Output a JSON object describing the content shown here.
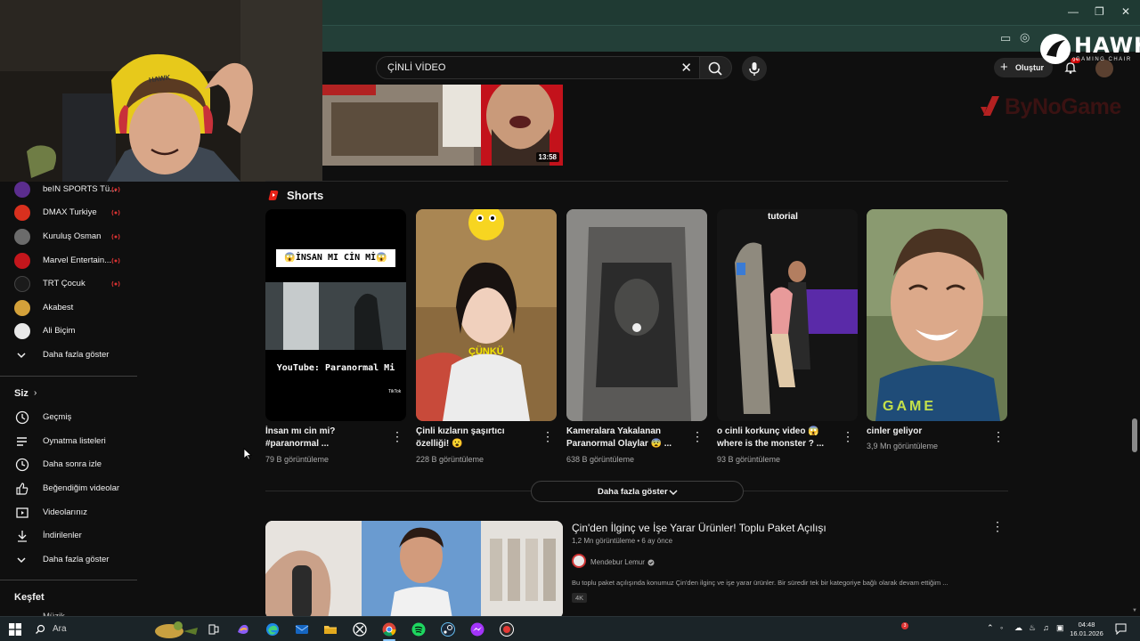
{
  "search": {
    "query": "ÇİNLİ VİDEO"
  },
  "header": {
    "create_label": "Oluştur",
    "notification_count": "9+"
  },
  "brand": {
    "hawk": "HAWK",
    "hawk_sub": "GAMING CHAIR",
    "bynogame": "ByNoGame",
    "headset_text": "HAWK"
  },
  "top_video": {
    "duration": "13:58"
  },
  "sidebar": {
    "subscriptions": [
      {
        "label": "beIN SPORTS Tü...",
        "color": "#5b2d8e"
      },
      {
        "label": "DMAX Turkiye",
        "color": "#d8301e"
      },
      {
        "label": "Kuruluş Osman",
        "color": "#6b6b6b"
      },
      {
        "label": "Marvel Entertain...",
        "color": "#c4161c"
      },
      {
        "label": "TRT Çocuk",
        "color": "#1b1b1b"
      },
      {
        "label": "Akabest",
        "color": "#d4a13a"
      },
      {
        "label": "Ali Biçim",
        "color": "#e8e8e8"
      }
    ],
    "show_more_1": "Daha fazla göster",
    "you_heading": "Siz",
    "you_items": [
      {
        "label": "Geçmiş",
        "icon": "history-icon"
      },
      {
        "label": "Oynatma listeleri",
        "icon": "playlist-icon"
      },
      {
        "label": "Daha sonra izle",
        "icon": "clock-icon"
      },
      {
        "label": "Beğendiğim videolar",
        "icon": "thumbs-up-icon"
      },
      {
        "label": "Videolarınız",
        "icon": "video-icon"
      },
      {
        "label": "İndirilenler",
        "icon": "download-icon"
      }
    ],
    "show_more_2": "Daha fazla göster",
    "explore_heading": "Keşfet",
    "explore_partial": "Müzik"
  },
  "shorts": {
    "title": "Shorts",
    "items": [
      {
        "title_line1": "İnsan mı cin mi?",
        "title_line2": "#paranormal ...",
        "views": "79 B görüntüleme",
        "overlay_top": "😱İNSAN MI CİN Mİ😱",
        "overlay_bottom": "YouTube: Paranormal Mi",
        "overlay_tag": "TikTok"
      },
      {
        "title_line1": "Çinli kızların şaşırtıcı",
        "title_line2": "özelliği! 😮",
        "views": "228 B görüntüleme",
        "overlay": "ÇÜNKÜ"
      },
      {
        "title_line1": "Kameralara Yakalanan",
        "title_line2": "Paranormal Olaylar 😨 ...",
        "views": "638 B görüntüleme"
      },
      {
        "title_line1": "o cinli korkunç video 😱",
        "title_line2": "where is the monster ? ...",
        "views": "93 B görüntüleme",
        "overlay": "tutorial"
      },
      {
        "title_line1": "cinler geliyor",
        "title_line2": "",
        "views": "3,9 Mn görüntüleme",
        "shirt_text": "GAME"
      }
    ],
    "show_more": "Daha fazla göster"
  },
  "video": {
    "title": "Çin'den İlginç ve İşe Yarar Ürünler! Toplu Paket Açılışı",
    "meta": "1,2 Mn görüntüleme • 6 ay önce",
    "channel": "Mendebur Lemur",
    "description": "Bu toplu paket açılışında konumuz Çin'den ilginç ve işe yarar ürünler. Bir süredir tek bir kategoriye bağlı olarak devam ettiğim ...",
    "badge": "4K"
  },
  "taskbar": {
    "search_placeholder": "Ara",
    "time": "04:48",
    "date": "16.01.2026",
    "badge": "3"
  }
}
